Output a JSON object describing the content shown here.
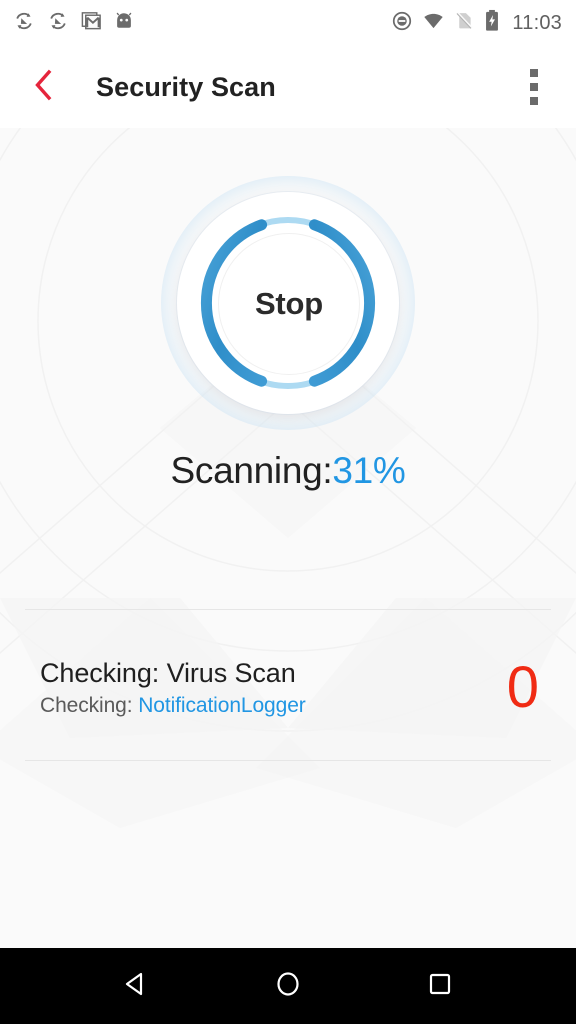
{
  "statusbar": {
    "time": "11:03",
    "left_icons": [
      "sync-icon",
      "sync-icon",
      "gmail-icon",
      "android-head-icon"
    ],
    "right_icons": [
      "do-not-disturb-icon",
      "wifi-icon",
      "no-sim-icon",
      "battery-charging-icon"
    ]
  },
  "appbar": {
    "back_icon": "chevron-left-icon",
    "title": "Security Scan",
    "overflow_icon": "more-vertical-icon",
    "back_color": "#e5253c",
    "title_color": "#222222"
  },
  "scanner": {
    "button_label": "Stop",
    "progress_percent": 31,
    "arc_color": "#3d97d0",
    "track_color": "#addaf2",
    "status_prefix": "Scanning:",
    "status_value": "31%",
    "status_value_color": "#2196e3"
  },
  "info": {
    "title": "Checking: Virus Scan",
    "sub_prefix": "Checking: ",
    "sub_link": "NotificationLogger",
    "sub_link_color": "#2196e3",
    "threat_count": "0",
    "threat_count_color": "#f02b14"
  },
  "navbar": {
    "back_icon": "nav-back-triangle-icon",
    "home_icon": "nav-home-circle-icon",
    "recents_icon": "nav-recents-square-icon"
  }
}
